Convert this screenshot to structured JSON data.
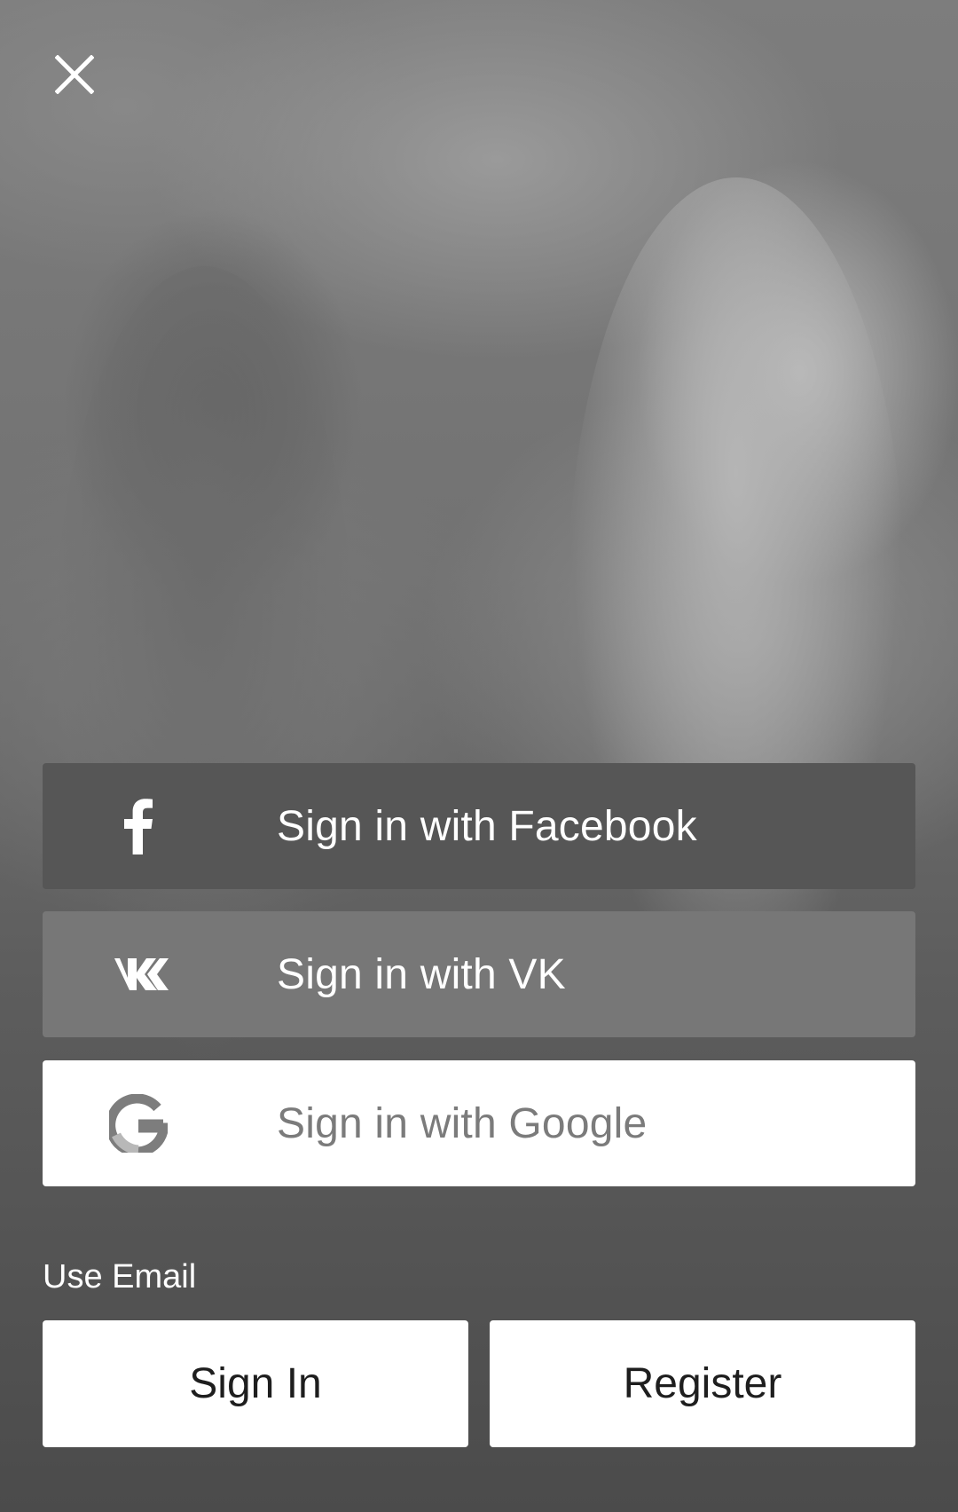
{
  "header": {
    "close_icon": "close-icon"
  },
  "social": [
    {
      "label": "Sign in with Facebook",
      "icon": "facebook-icon"
    },
    {
      "label": "Sign in with VK",
      "icon": "vk-icon"
    },
    {
      "label": "Sign in with Google",
      "icon": "google-icon"
    }
  ],
  "email": {
    "section_label": "Use Email",
    "sign_in_label": "Sign In",
    "register_label": "Register"
  },
  "colors": {
    "facebook_button": "#565656",
    "vk_button": "#777777",
    "google_button": "#ffffff",
    "google_text": "#7b7b7b",
    "email_button": "#ffffff",
    "email_button_text": "#1e1e1e"
  }
}
